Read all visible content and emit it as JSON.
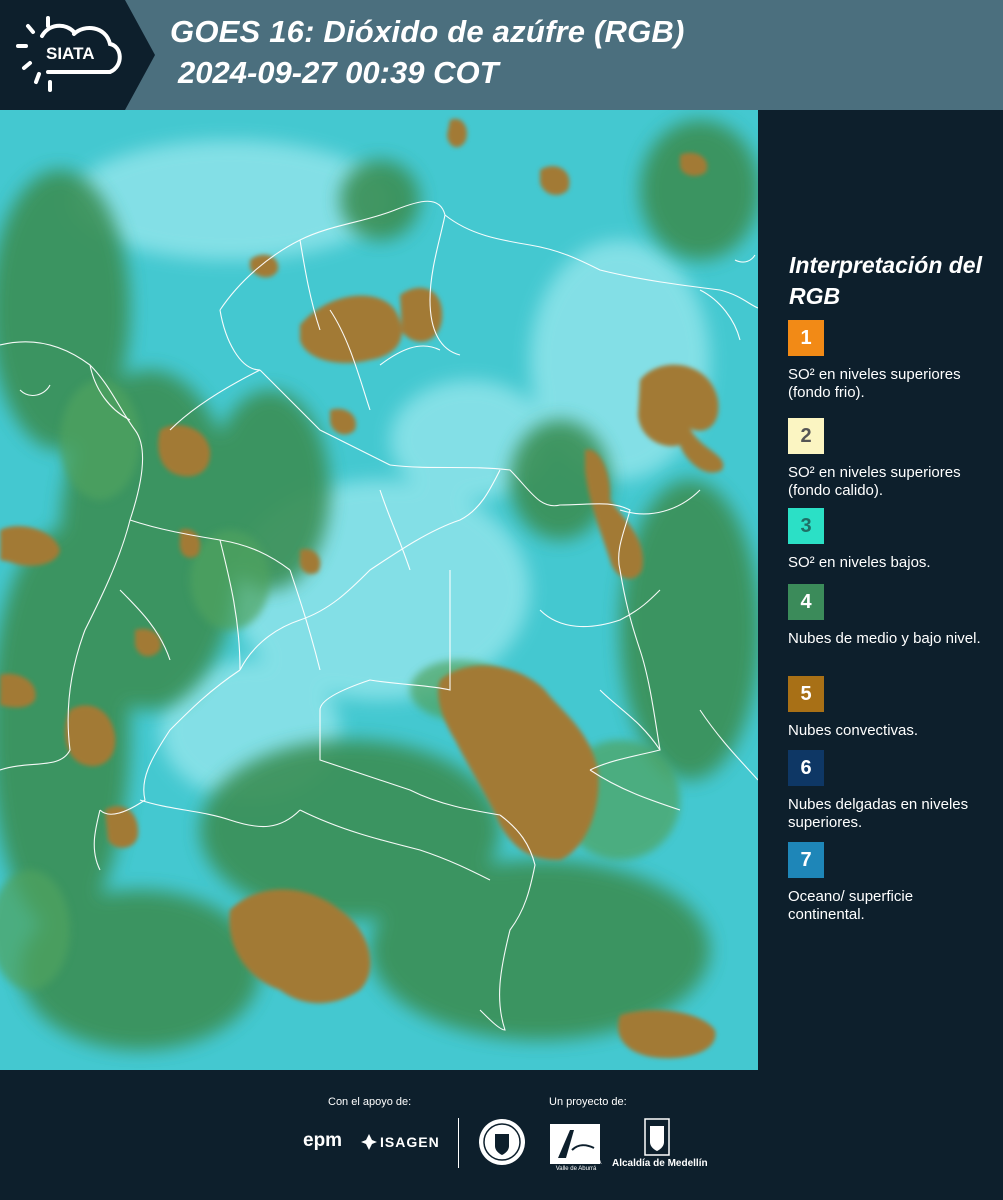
{
  "header": {
    "logo_text": "SIATA",
    "title": "GOES 16: Dióxido de azúfre (RGB)",
    "datetime": "2024-09-27 00:39 COT"
  },
  "legend": {
    "title": "Interpretación del RGB",
    "items": [
      {
        "number": "1",
        "color": "#f28a16",
        "description": "SO² en niveles superiores (fondo frio)."
      },
      {
        "number": "2",
        "color": "#fbf5c2",
        "description": "SO² en niveles superiores (fondo calido)."
      },
      {
        "number": "3",
        "color": "#2be0c6",
        "description": "SO² en niveles bajos."
      },
      {
        "number": "4",
        "color": "#3b8b5a",
        "description": "Nubes de medio y bajo nivel."
      },
      {
        "number": "5",
        "color": "#a87016",
        "description": "Nubes convectivas."
      },
      {
        "number": "6",
        "color": "#0e3765",
        "description": "Nubes delgadas en niveles superiores."
      },
      {
        "number": "7",
        "color": "#1e86b8",
        "description": "Oceano/ superficie continental."
      }
    ]
  },
  "footer": {
    "support_label": "Con el apoyo de:",
    "project_label": "Un proyecto de:",
    "sponsors": [
      "epm",
      "ISAGEN"
    ],
    "partners": [
      "METROPOLITANA Valle de Aburrá",
      "Alcaldía de Medellín"
    ]
  },
  "colors": {
    "header_bg": "#4b6f7e",
    "panel_bg": "#0d1f2c",
    "map_base": "#3fc9cf",
    "cloud_green": "#3a8f55",
    "convective": "#a27a35"
  }
}
